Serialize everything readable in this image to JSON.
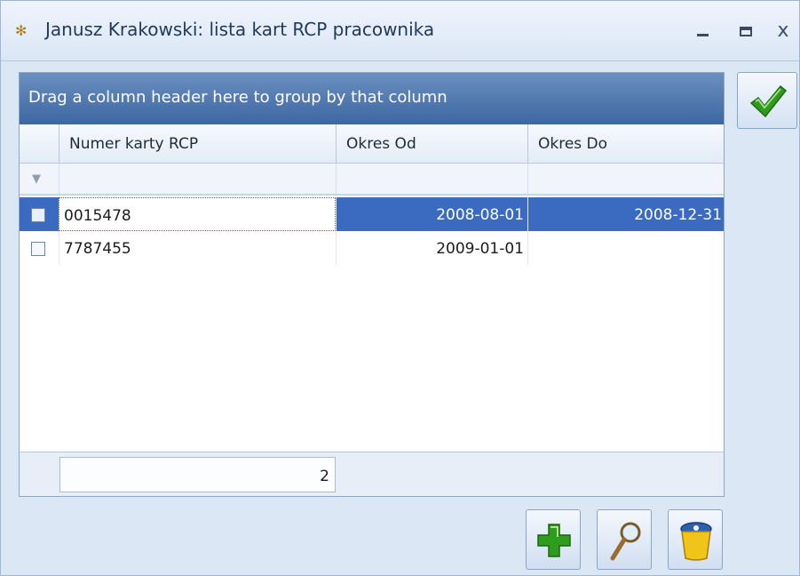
{
  "window": {
    "title": "Janusz Krakowski: lista kart RCP pracownika",
    "minimize_glyph": "minimize-icon",
    "maximize_glyph": "maximize-icon",
    "close_glyph": "x"
  },
  "grid": {
    "group_panel_text": "Drag a column header here to group by that column",
    "columns": [
      "Numer karty RCP",
      "Okres Od",
      "Okres Do"
    ],
    "rows": [
      {
        "numer": "0015478",
        "od": "2008-08-01",
        "do": "2008-12-31",
        "selected": true
      },
      {
        "numer": "7787455",
        "od": "2009-01-01",
        "do": "",
        "selected": false
      }
    ],
    "footer_count": "2"
  },
  "colors": {
    "selection": "#3a6bc0",
    "group_panel": "#4f77b0",
    "ok_check": "#2f9a1f",
    "add_plus": "#2e9c1c",
    "trash": "#f0c419"
  },
  "icons": {
    "ok": "checkmark-icon",
    "add": "plus-icon",
    "find": "magnifier-icon",
    "delete": "trash-icon",
    "filter": "filter-icon",
    "app": "app-icon"
  }
}
